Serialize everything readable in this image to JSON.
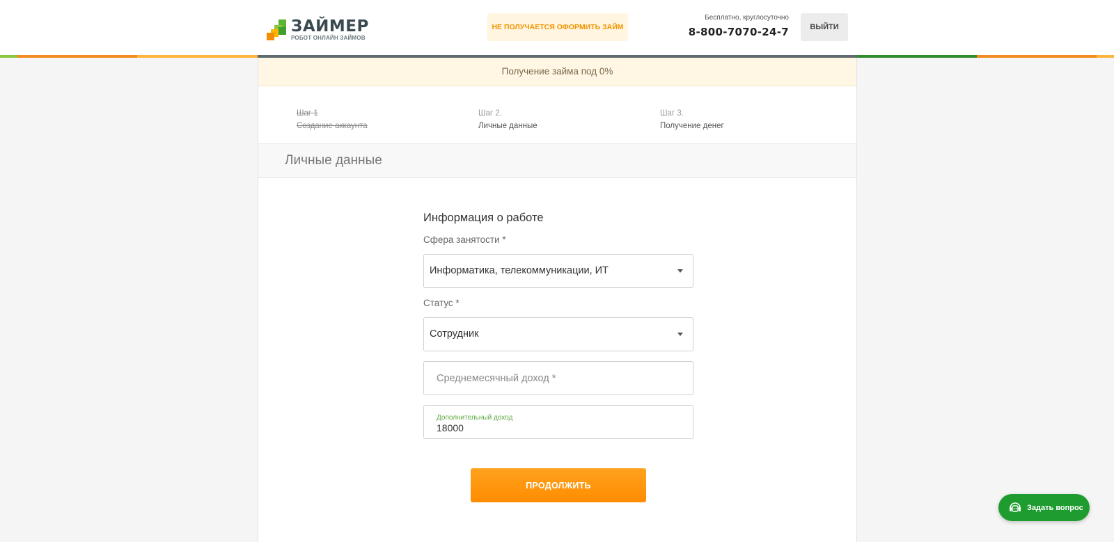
{
  "header": {
    "logo_title": "ЗАЙМЕР",
    "logo_subtitle": "РОБОТ ОНЛАЙН ЗАЙМОВ",
    "help_button": "НЕ ПОЛУЧАЕТСЯ ОФОРМИТЬ ЗАЙМ",
    "support_label": "Бесплатно, круглосуточно",
    "support_phone": "8-800-7070-24-7",
    "logout_button": "ВЫЙТИ"
  },
  "promo_text": "Получение займа под 0%",
  "steps": [
    {
      "number": "Шаг 1",
      "title": "Создание аккаунта",
      "state": "done"
    },
    {
      "number": "Шаг 2.",
      "title": "Личные данные",
      "state": "current"
    },
    {
      "number": "Шаг 3.",
      "title": "Получение денег",
      "state": "upcoming"
    }
  ],
  "section_title": "Личные данные",
  "form": {
    "title": "Информация о работе",
    "employment_label": "Сфера занятости *",
    "employment_value": "Информатика, телекоммуникации, ИТ",
    "status_label": "Статус *",
    "status_value": "Сотрудник",
    "income_placeholder": "Среднемесячный доход *",
    "extra_income_label": "Дополнительный доход",
    "extra_income_value": "18000",
    "submit_button": "ПРОДОЛЖИТЬ"
  },
  "chat_button": "Задать вопрос",
  "colors": {
    "accent_orange": "#ff8c00",
    "brand_green": "#1f9c2f",
    "promo_bg": "#fff6e3"
  }
}
